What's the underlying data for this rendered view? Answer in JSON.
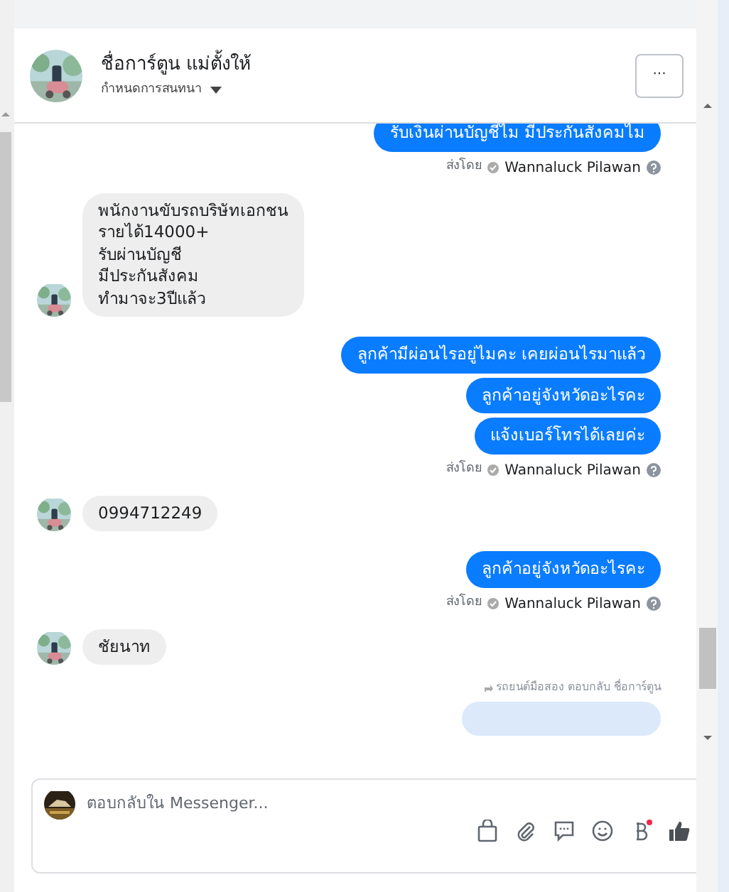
{
  "header": {
    "name": "ชื่อการ์ตูน แม่ตั้งให้",
    "subtitle": "กำหนดการสนทนา",
    "more": "···"
  },
  "messages": [
    {
      "kind": "out",
      "text": "รับเงินผ่านบัญชีไม  มีประกันสังคมไม"
    },
    {
      "kind": "sent_by",
      "prefix": "ส่งโดย",
      "name": "Wannaluck Pilawan"
    },
    {
      "kind": "in",
      "text": "พนักงานขับรถบริษัทเอกชน\nรายได้14000+\nรับผ่านบัญชี\nมีประกันสังคม\nทำมาจะ3ปีแล้ว"
    },
    {
      "kind": "out",
      "text": "ลูกค้ามีผ่อนไรอยู่ไมคะ เคยผ่อนไรมาแล้ว"
    },
    {
      "kind": "out",
      "text": "ลูกค้าอยู่จังหวัดอะไรคะ"
    },
    {
      "kind": "out",
      "text": "แจ้งเบอร์โทรได้เลยค่ะ"
    },
    {
      "kind": "sent_by",
      "prefix": "ส่งโดย",
      "name": "Wannaluck Pilawan"
    },
    {
      "kind": "in",
      "text": "0994712249"
    },
    {
      "kind": "out",
      "text": "ลูกค้าอยู่จังหวัดอะไรคะ"
    },
    {
      "kind": "sent_by",
      "prefix": "ส่งโดย",
      "name": "Wannaluck Pilawan"
    },
    {
      "kind": "in",
      "text": "ชัยนาท"
    },
    {
      "kind": "reply_note",
      "text": "รถยนต์มือสอง ตอบกลับ ชื่อการ์ตูน"
    },
    {
      "kind": "out_cut"
    }
  ],
  "composer": {
    "placeholder": "ตอบกลับใน Messenger..."
  }
}
